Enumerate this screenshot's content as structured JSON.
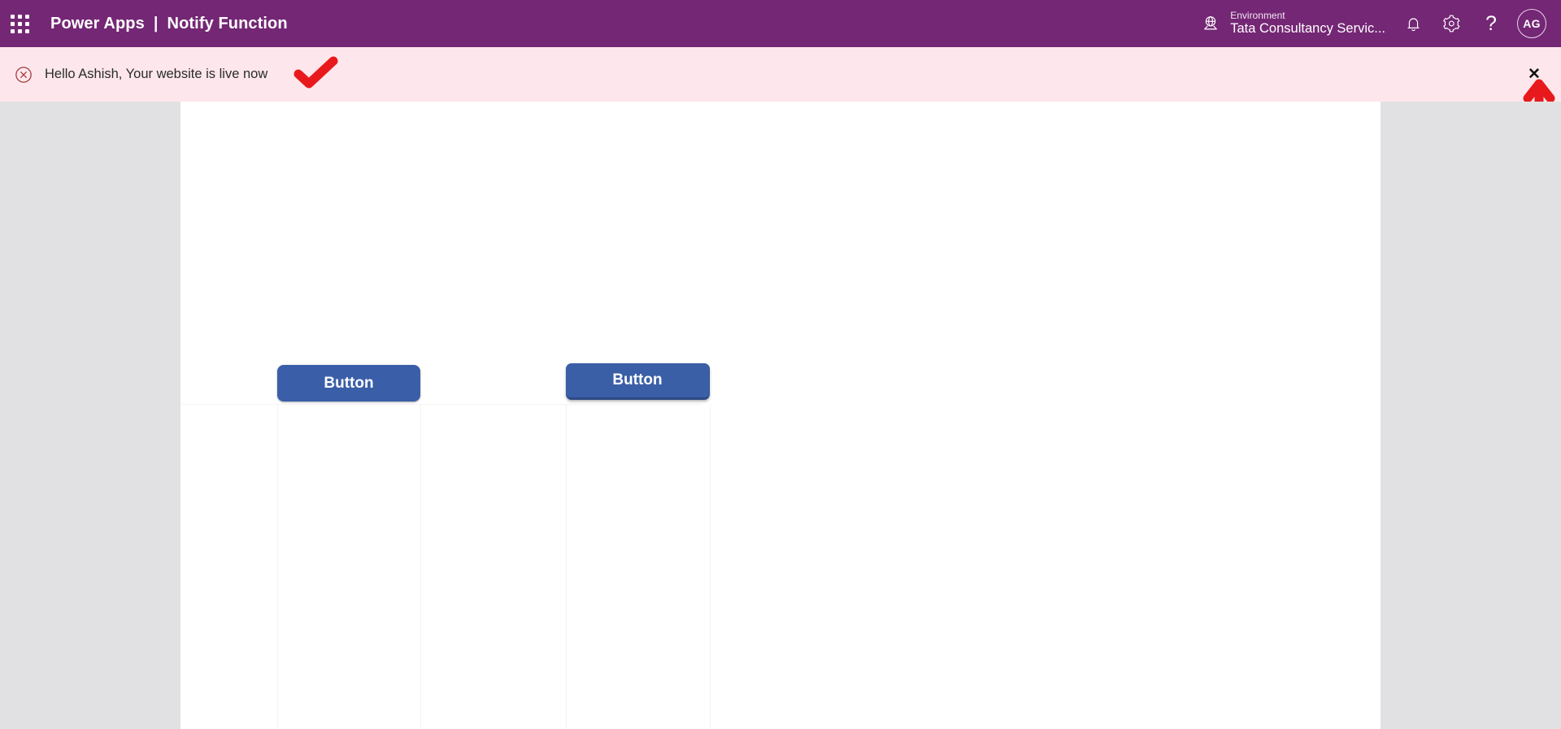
{
  "header": {
    "waffle_icon": "app-launcher-waffle-icon",
    "product_name": "Power Apps",
    "separator": "|",
    "app_name": "Notify Function",
    "environment": {
      "icon": "environment-globe-icon",
      "label": "Environment",
      "value": "Tata Consultancy Servic..."
    },
    "actions": [
      {
        "icon": "notification-bell-icon",
        "name": "notifications-button"
      },
      {
        "icon": "gear-icon",
        "name": "settings-button"
      },
      {
        "icon": "question-mark-icon",
        "name": "help-button",
        "glyph": "?"
      }
    ],
    "avatar": {
      "initials": "AG",
      "name": "user-avatar"
    }
  },
  "banner": {
    "icon": "error-circle-x-icon",
    "message": "Hello Ashish, Your website is live now",
    "close_glyph": "✕",
    "background_color": "#fde7ec",
    "icon_color": "#a4373a"
  },
  "annotations": {
    "checkmark": {
      "name": "red-checkmark-annotation",
      "color": "#e8191c"
    },
    "arrow": {
      "name": "red-up-arrow-annotation",
      "color": "#e8191c"
    }
  },
  "canvas": {
    "background_color": "#ffffff",
    "buttons": [
      {
        "label": "Button",
        "name": "canvas-button-1",
        "color": "#3a5fa8"
      },
      {
        "label": "Button",
        "name": "canvas-button-2",
        "color": "#3b5fa6"
      }
    ]
  },
  "colors": {
    "header_purple": "#742774",
    "banner_pink": "#fde7ec",
    "workspace_gray": "#e1e1e3",
    "button_blue": "#3a5fa8",
    "annotation_red": "#e8191c"
  }
}
